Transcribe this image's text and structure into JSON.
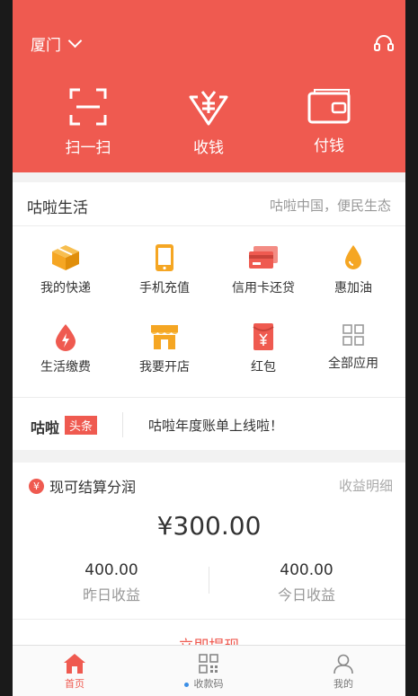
{
  "header": {
    "city": "厦门",
    "actions": [
      {
        "label": "扫一扫",
        "icon": "scan-icon"
      },
      {
        "label": "收钱",
        "icon": "receive-money-icon"
      },
      {
        "label": "付钱",
        "icon": "wallet-icon"
      }
    ]
  },
  "life": {
    "title": "咕啦生活",
    "subtitle": "咕啦中国，便民生态",
    "items": [
      {
        "label": "我的快递",
        "icon": "package-icon"
      },
      {
        "label": "手机充值",
        "icon": "phone-icon"
      },
      {
        "label": "信用卡还贷",
        "icon": "credit-card-icon"
      },
      {
        "label": "惠加油",
        "icon": "fuel-drop-icon"
      },
      {
        "label": "生活缴费",
        "icon": "utility-bolt-icon"
      },
      {
        "label": "我要开店",
        "icon": "store-icon"
      },
      {
        "label": "红包",
        "icon": "red-envelope-icon"
      },
      {
        "label": "全部应用",
        "icon": "all-apps-icon"
      }
    ]
  },
  "news": {
    "brand": "咕啦",
    "tag": "头条",
    "headline": "咕啦年度账单上线啦！"
  },
  "earnings": {
    "title": "现可结算分润",
    "link": "收益明细",
    "amount": "¥300.00",
    "yesterday_value": "400.00",
    "yesterday_label": "昨日收益",
    "today_value": "400.00",
    "today_label": "今日收益",
    "withdraw": "立即提现"
  },
  "tabs": [
    {
      "label": "首页",
      "icon": "home-icon",
      "active": true
    },
    {
      "label": "收款码",
      "icon": "qr-code-icon",
      "active": false
    },
    {
      "label": "我的",
      "icon": "profile-icon",
      "active": false
    }
  ],
  "colors": {
    "accent": "#ef5a50",
    "icon_orange": "#f5a623",
    "background": "#f2f2f2"
  }
}
